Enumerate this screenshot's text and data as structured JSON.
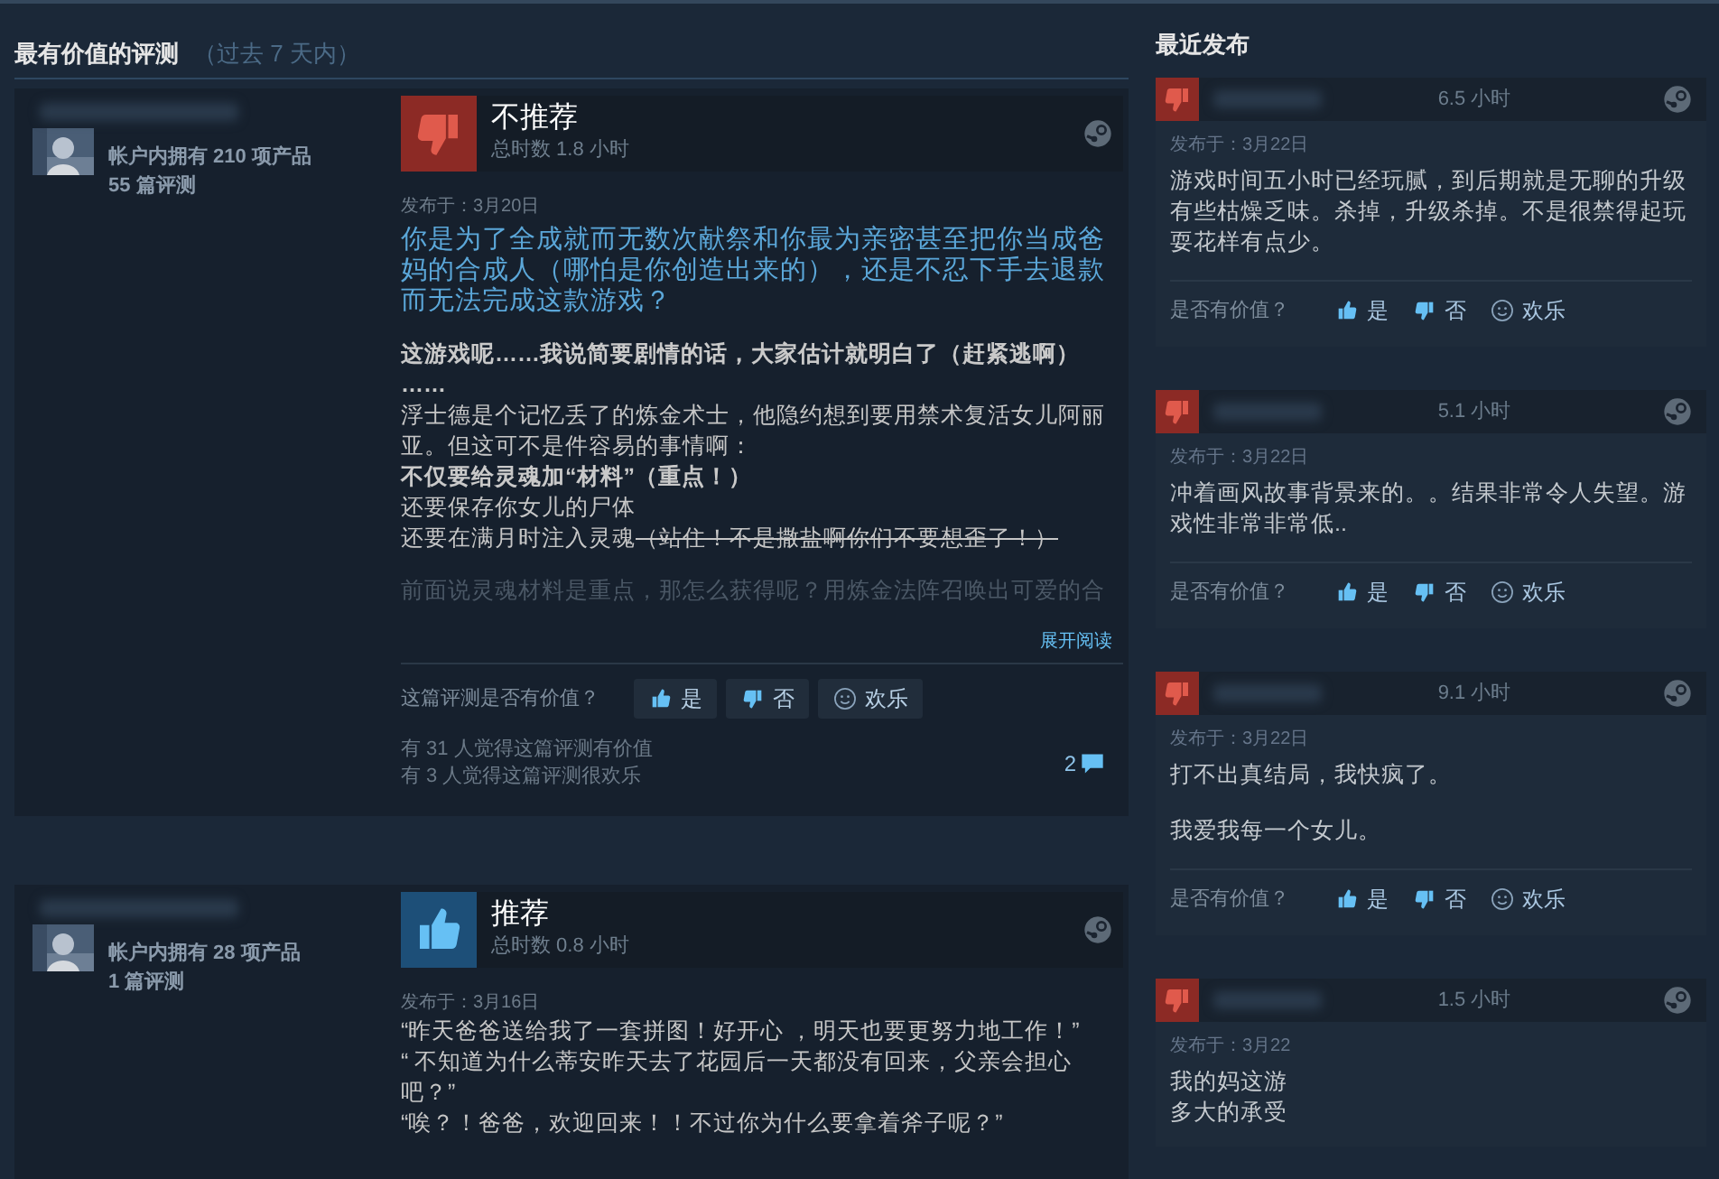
{
  "most_helpful": {
    "title": "最有价值的评测",
    "subtitle": "（过去 7 天内）",
    "reviews": [
      {
        "author": {
          "products": "帐户内拥有 210 项产品",
          "reviews": "55 篇评测"
        },
        "recommended": false,
        "verdict": "不推荐",
        "hours": "总时数 1.8 小时",
        "posted": "发布于：3月20日",
        "paragraphs": [
          [
            {
              "kind": "highlight",
              "text": "你是为了全成就而无数次献祭和你最为亲密甚至把你当成爸妈的合成人（哪怕是你创造出来的），还是不忍下手去退款而无法完成这款游戏？"
            }
          ],
          [
            {
              "kind": "bold",
              "text": "这游戏呢……我说简要剧情的话，大家估计就明白了（赶紧逃啊）"
            },
            {
              "kind": "bold",
              "text": "……"
            },
            {
              "kind": "plain",
              "text": "浮士德是个记忆丢了的炼金术士，他隐约想到要用禁术复活女儿阿丽亚。但这可不是件容易的事情啊："
            },
            {
              "kind": "bold",
              "text": "不仅要给灵魂加“材料”（重点！）"
            },
            {
              "kind": "plain",
              "text": "还要保存你女儿的尸体"
            },
            {
              "kind": "plain",
              "text": "还要在满月时注入灵魂",
              "struck": "（站住！不是撒盐啊你们不要想歪了！）"
            }
          ],
          [
            {
              "kind": "faded",
              "text": "前面说灵魂材料是重点，那怎么获得呢？用炼金法阵召唤出可爱的合"
            }
          ]
        ],
        "read_more": "展开阅读",
        "helpful_prompt": "这篇评测是否有价值？",
        "votes": [
          {
            "kind": "up",
            "label": "是"
          },
          {
            "kind": "down",
            "label": "否"
          },
          {
            "kind": "funny",
            "label": "欢乐"
          }
        ],
        "helpful_count": "有 31 人觉得这篇评测有价值",
        "funny_count": "有 3 人觉得这篇评测很欢乐",
        "comments": "2"
      },
      {
        "author": {
          "products": "帐户内拥有 28 项产品",
          "reviews": "1 篇评测"
        },
        "recommended": true,
        "verdict": "推荐",
        "hours": "总时数 0.8 小时",
        "posted": "发布于：3月16日",
        "paragraphs": [
          [
            {
              "kind": "plain",
              "text": "“昨天爸爸送给我了一套拼图！好开心 ，明天也要更努力地工作！”"
            },
            {
              "kind": "plain",
              "text": "“ 不知道为什么蒂安昨天去了花园后一天都没有回来，父亲会担心吧？”"
            },
            {
              "kind": "plain",
              "text": "“唉？！爸爸，欢迎回来！！不过你为什么要拿着斧子呢？”"
            }
          ]
        ]
      }
    ]
  },
  "recent": {
    "title": "最近发布",
    "reviews": [
      {
        "recommended": false,
        "hours": "6.5 小时",
        "posted": "发布于：3月22日",
        "paragraphs": [
          [
            "游戏时间五小时已经玩腻，到后期就是无聊的升级有些枯燥乏味。杀掉，升级杀掉。不是很禁得起玩耍花样有点少。"
          ]
        ],
        "helpful_prompt": "是否有价值？",
        "votes": [
          {
            "kind": "up",
            "label": "是"
          },
          {
            "kind": "down",
            "label": "否"
          },
          {
            "kind": "funny",
            "label": "欢乐"
          }
        ]
      },
      {
        "recommended": false,
        "hours": "5.1 小时",
        "posted": "发布于：3月22日",
        "paragraphs": [
          [
            "冲着画风故事背景来的。。结果非常令人失望。游戏性非常非常低.."
          ]
        ],
        "helpful_prompt": "是否有价值？",
        "votes": [
          {
            "kind": "up",
            "label": "是"
          },
          {
            "kind": "down",
            "label": "否"
          },
          {
            "kind": "funny",
            "label": "欢乐"
          }
        ]
      },
      {
        "recommended": false,
        "hours": "9.1 小时",
        "posted": "发布于：3月22日",
        "paragraphs": [
          [
            "打不出真结局，我快疯了。"
          ],
          [
            "我爱我每一个女儿。"
          ]
        ],
        "helpful_prompt": "是否有价值？",
        "votes": [
          {
            "kind": "up",
            "label": "是"
          },
          {
            "kind": "down",
            "label": "否"
          },
          {
            "kind": "funny",
            "label": "欢乐"
          }
        ]
      },
      {
        "recommended": false,
        "hours": "1.5 小时",
        "posted": "发布于：3月22",
        "paragraphs": [
          [
            "我的妈这游",
            "多大的承受"
          ]
        ]
      }
    ]
  }
}
